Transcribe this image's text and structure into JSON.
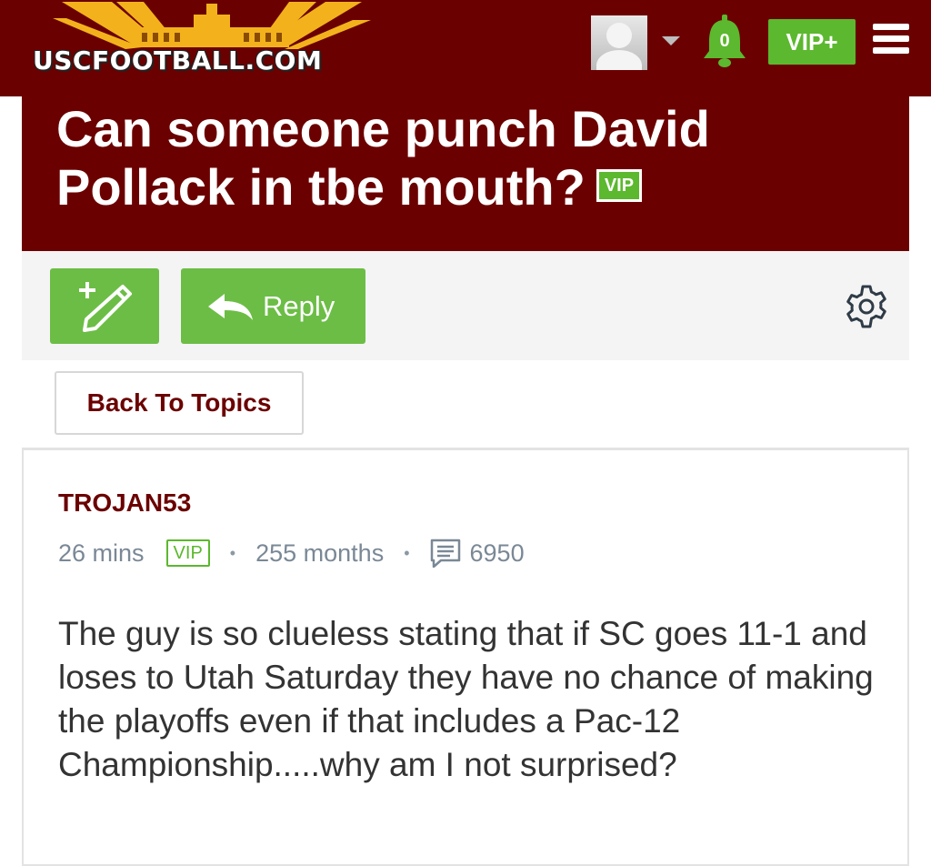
{
  "header": {
    "logo_text": "USCFOOTBALL.COM",
    "avatar_icon": "user-avatar-placeholder",
    "notification_count": "0",
    "vip_plus_label": "VIP+",
    "menu_icon": "hamburger-icon",
    "colors": {
      "brand": "#6b0000",
      "gold": "#f3b21c",
      "accent_green": "#5cb82e"
    }
  },
  "thread": {
    "title": "Can someone punch David Pollack in tbe mouth?",
    "title_badge": "VIP"
  },
  "toolbar": {
    "new_topic_icon": "new-topic-pencil-icon",
    "reply_label": "Reply",
    "settings_icon": "gear-icon"
  },
  "nav": {
    "back_label": "Back To Topics"
  },
  "post": {
    "author": "TROJAN53",
    "time": "26 mins",
    "badge": "VIP",
    "member_for": "255 months",
    "separator": "•",
    "post_count": "6950",
    "body": "The guy is so clueless stating that if SC goes 11-1 and loses to Utah Saturday they have no chance of making the playoffs even if that includes a Pac-12 Championship.....why am I not surprised?"
  }
}
